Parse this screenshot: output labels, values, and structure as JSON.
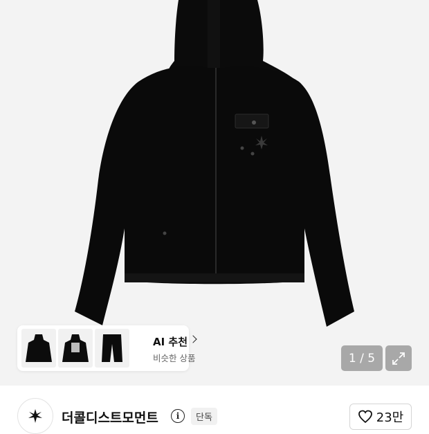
{
  "product": {
    "image_counter": "1 / 5",
    "image_name": "black zip-up hoodie"
  },
  "recommend": {
    "title": "AI 추천",
    "subtitle": "비슷한 상품",
    "thumbnails": [
      "hoodie-front",
      "hoodie-back-print",
      "jogger-pants"
    ]
  },
  "brand": {
    "name": "더콜디스트모먼트",
    "badge": "단독",
    "like_count": "23만"
  },
  "icons": {
    "expand": "expand-icon",
    "info": "info-icon",
    "heart": "heart-icon",
    "chevron": "chevron-right-icon",
    "logo": "brand-logo"
  }
}
